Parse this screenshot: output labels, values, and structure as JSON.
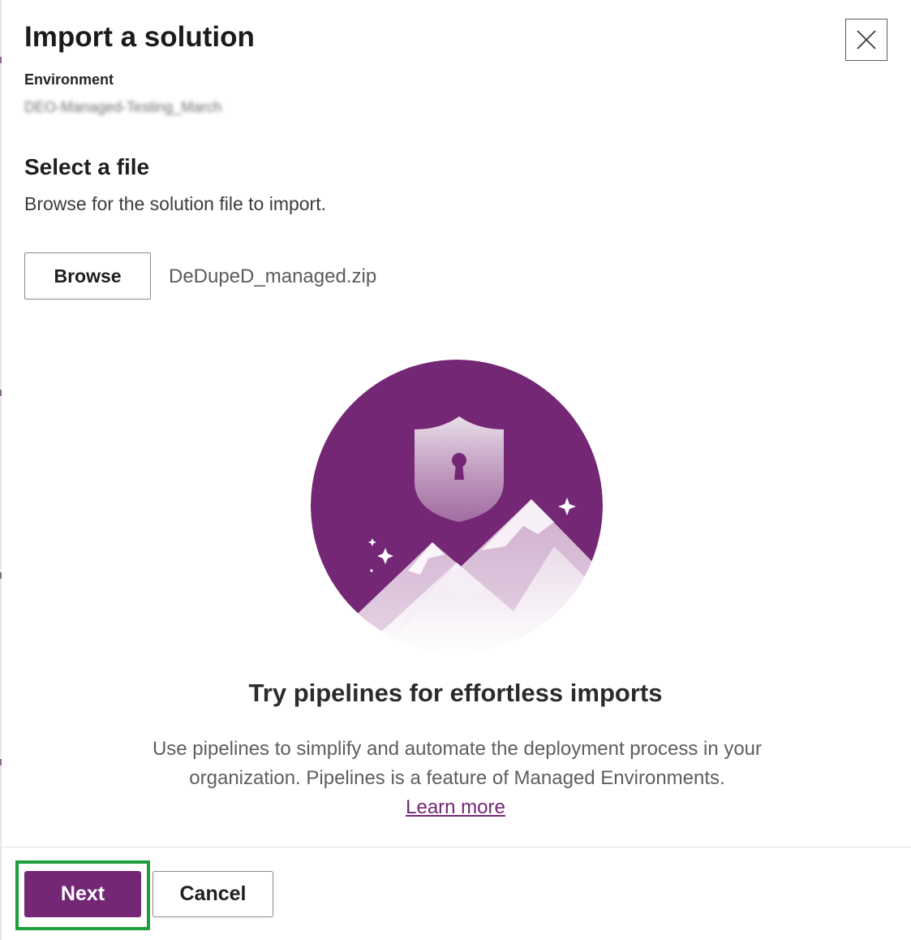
{
  "dialog": {
    "title": "Import a solution",
    "close_icon": "close-icon"
  },
  "environment": {
    "label": "Environment",
    "value": "DEO-Managed-Testing_March"
  },
  "file_section": {
    "title": "Select a file",
    "description": "Browse for the solution file to import.",
    "browse_label": "Browse",
    "file_name": "DeDupeD_managed.zip"
  },
  "promo": {
    "illustration_icon": "shield-mountains-illustration",
    "title": "Try pipelines for effortless imports",
    "description": "Use pipelines to simplify and automate the deployment process in your organization. Pipelines is a feature of Managed Environments.",
    "learn_more": "Learn more"
  },
  "footer": {
    "next_label": "Next",
    "cancel_label": "Cancel"
  },
  "colors": {
    "brand": "#742774",
    "highlight": "#1e9e3c"
  }
}
